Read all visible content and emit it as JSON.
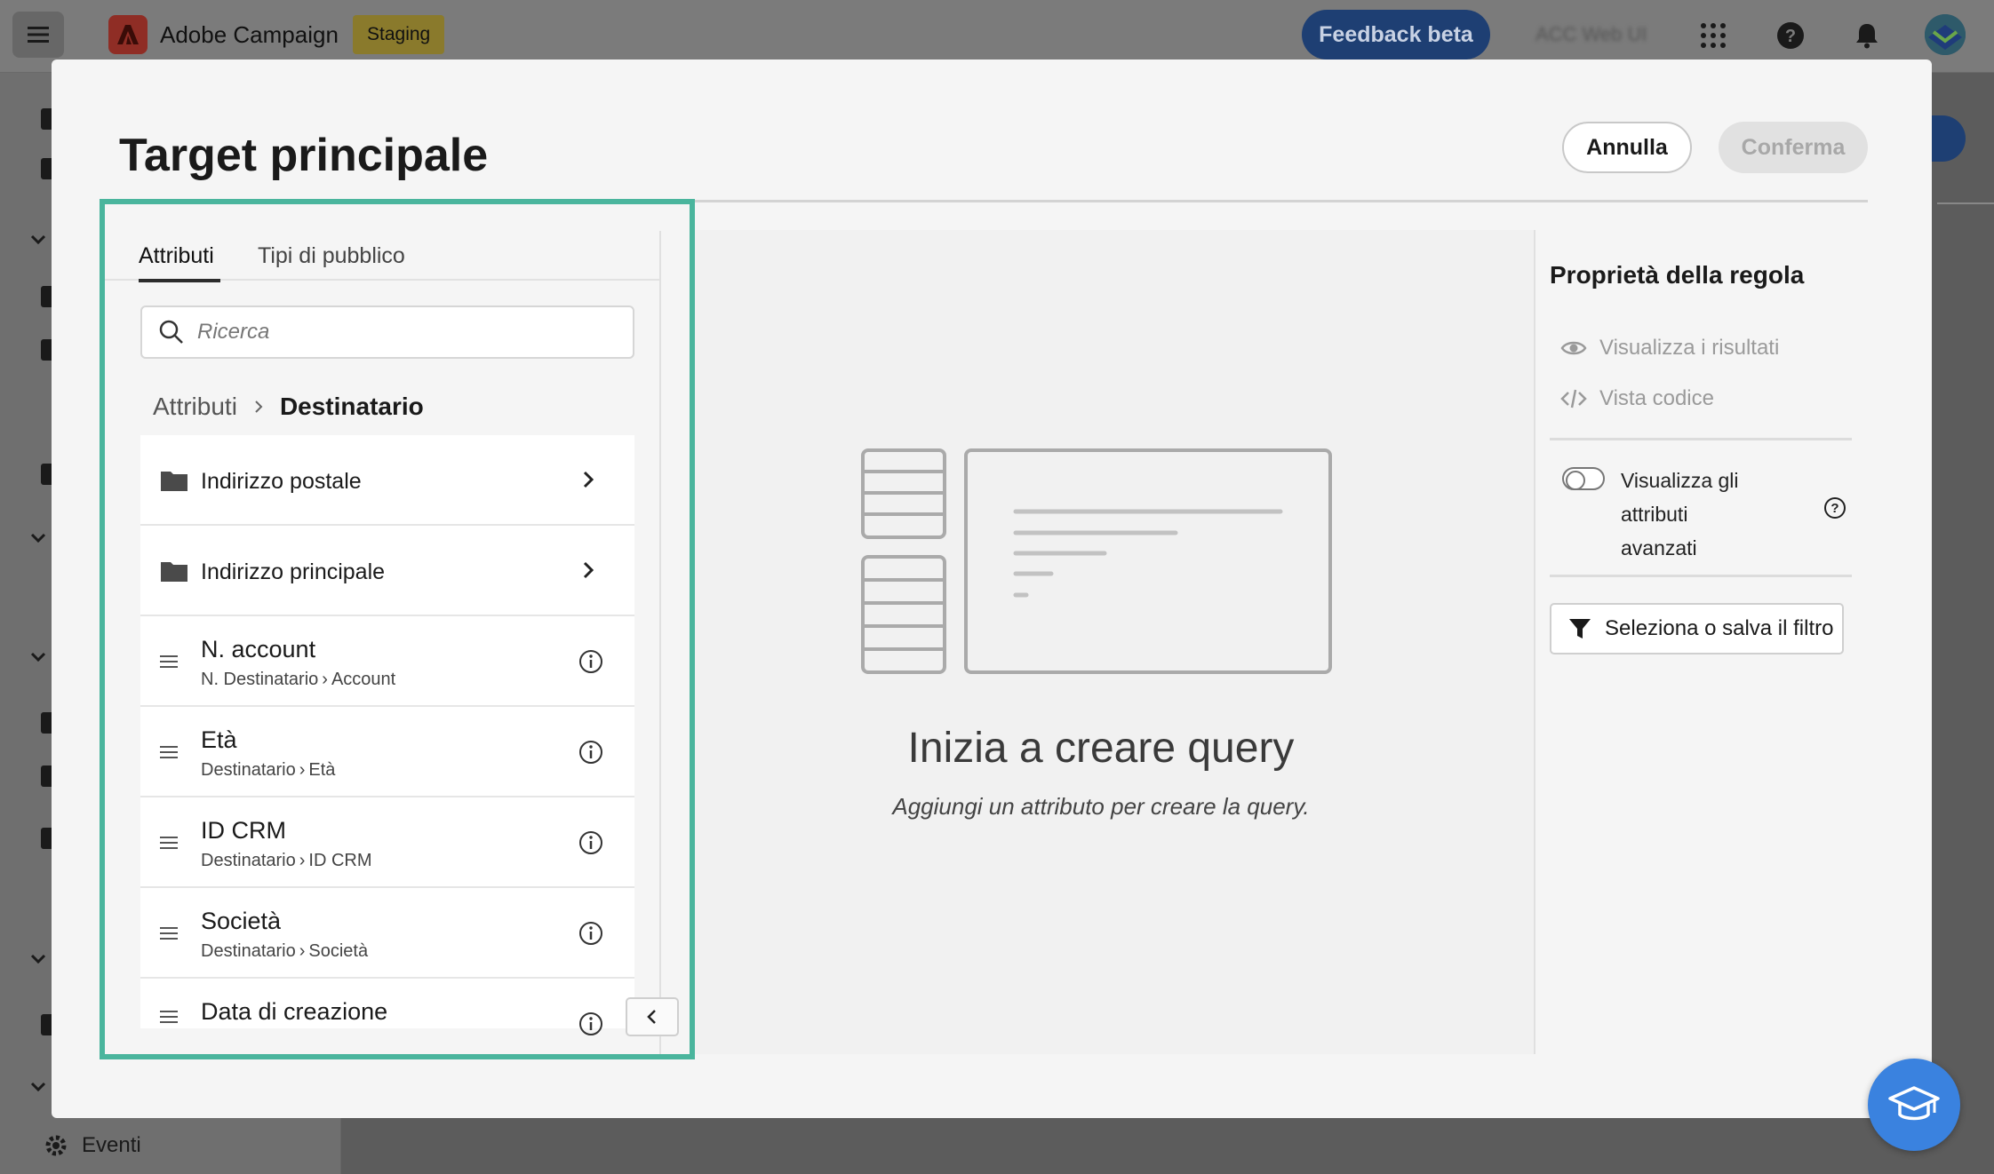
{
  "app": {
    "title": "Adobe Campaign",
    "environment_badge": "Staging",
    "feedback_label": "Feedback beta",
    "org_name": "ACC Web UI"
  },
  "background": {
    "sidebar_bottom_item": "Eventi"
  },
  "modal": {
    "title": "Target principale",
    "cancel_label": "Annulla",
    "confirm_label": "Conferma"
  },
  "attributes_panel": {
    "tabs": [
      {
        "label": "Attributi",
        "active": true
      },
      {
        "label": "Tipi di pubblico",
        "active": false
      }
    ],
    "search_placeholder": "Ricerca",
    "breadcrumb": [
      "Attributi",
      "Destinatario"
    ],
    "items": [
      {
        "type": "folder",
        "label": "Indirizzo postale"
      },
      {
        "type": "folder",
        "label": "Indirizzo principale"
      },
      {
        "type": "attribute",
        "label": "N. account",
        "path": [
          "N. Destinatario",
          "Account"
        ]
      },
      {
        "type": "attribute",
        "label": "Età",
        "path": [
          "Destinatario",
          "Età"
        ]
      },
      {
        "type": "attribute",
        "label": "ID CRM",
        "path": [
          "Destinatario",
          "ID CRM"
        ]
      },
      {
        "type": "attribute",
        "label": "Società",
        "path": [
          "Destinatario",
          "Società"
        ]
      },
      {
        "type": "attribute",
        "label": "Data di creazione",
        "path": []
      }
    ]
  },
  "canvas": {
    "empty_title": "Inizia a creare query",
    "empty_subtitle": "Aggiungi un attributo per creare la query."
  },
  "rule_properties": {
    "title": "Proprietà della regola",
    "view_results_label": "Visualizza i risultati",
    "code_view_label": "Vista codice",
    "advanced_toggle_label": "Visualizza gli attributi avanzati",
    "advanced_toggle_on": false,
    "filter_button_label": "Seleziona o salva il filtro"
  },
  "colors": {
    "highlight": "#4ab59d",
    "primary_blue": "#1e3f73",
    "fab_blue": "#3a82df"
  }
}
